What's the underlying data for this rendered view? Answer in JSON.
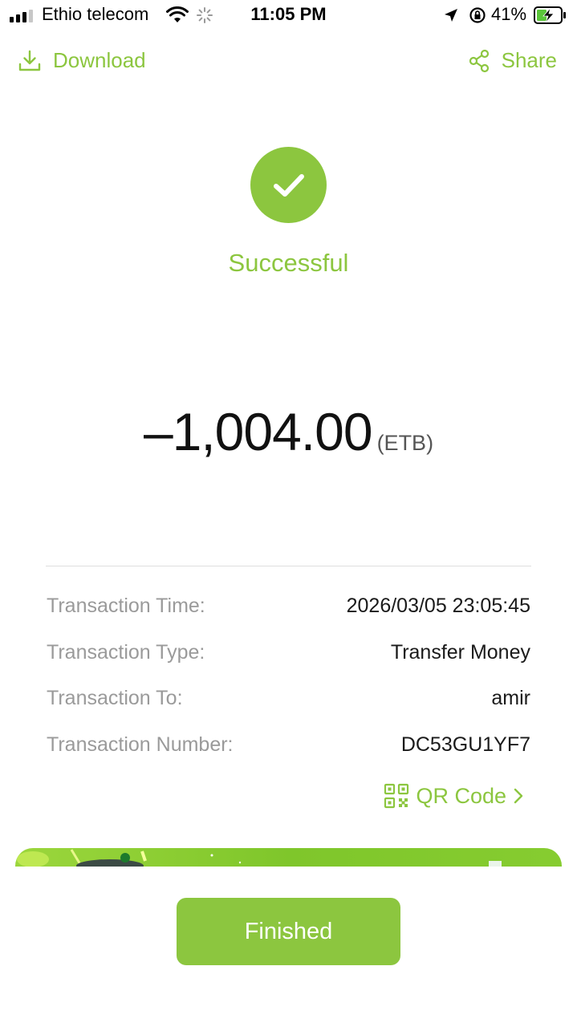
{
  "status_bar": {
    "carrier": "Ethio telecom",
    "time": "11:05 PM",
    "battery": "41%"
  },
  "actions": {
    "download": "Download",
    "share": "Share"
  },
  "result": {
    "status": "Successful",
    "amount": "–1,004.00",
    "currency": "(ETB)"
  },
  "details": [
    {
      "label": "Transaction Time:",
      "value": "2026/03/05 23:05:45"
    },
    {
      "label": "Transaction Type:",
      "value": "Transfer Money"
    },
    {
      "label": "Transaction To:",
      "value": "amir"
    },
    {
      "label": "Transaction Number:",
      "value": "DC53GU1YF7"
    }
  ],
  "qr_code": {
    "label": "QR Code"
  },
  "finished_button": {
    "label": "Finished"
  },
  "colors": {
    "accent": "#8cc63f",
    "label_gray": "#9a9a9a"
  }
}
